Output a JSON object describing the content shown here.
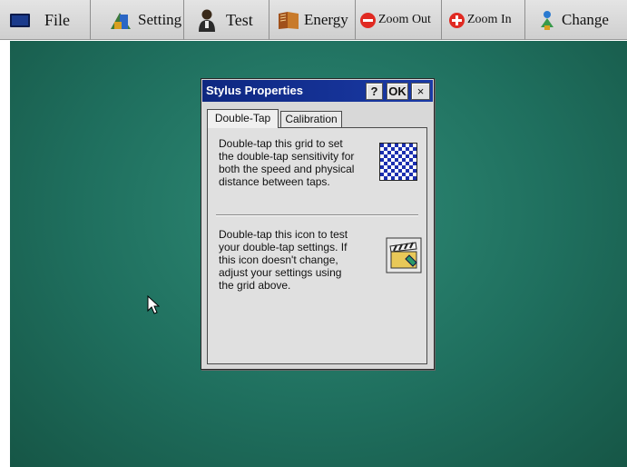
{
  "toolbar": {
    "items": [
      {
        "label": "File",
        "icon": "monitor-icon"
      },
      {
        "label": "Setting",
        "icon": "setting-icon"
      },
      {
        "label": "Test",
        "icon": "person-icon"
      },
      {
        "label": "Energy",
        "icon": "book-icon"
      },
      {
        "label": "Zoom Out",
        "icon": "zoom-out-icon"
      },
      {
        "label": "Zoom In",
        "icon": "zoom-in-icon"
      },
      {
        "label": "Change",
        "icon": "change-icon"
      }
    ]
  },
  "dialog": {
    "title": "Stylus Properties",
    "help_label": "?",
    "ok_label": "OK",
    "close_label": "×",
    "tabs": [
      {
        "label": "Double-Tap",
        "selected": true
      },
      {
        "label": "Calibration",
        "selected": false
      }
    ],
    "grid_description": "Double-tap this grid to set the double-tap sensitivity for both the speed and physical distance between taps.",
    "icon_description": "Double-tap this icon to test your double-tap settings. If this icon doesn't change, adjust your settings using the grid above."
  },
  "colors": {
    "desktop": "#1f6f5e",
    "title_bar": "#0e2780",
    "zoom_buttons": "#e02a22"
  }
}
